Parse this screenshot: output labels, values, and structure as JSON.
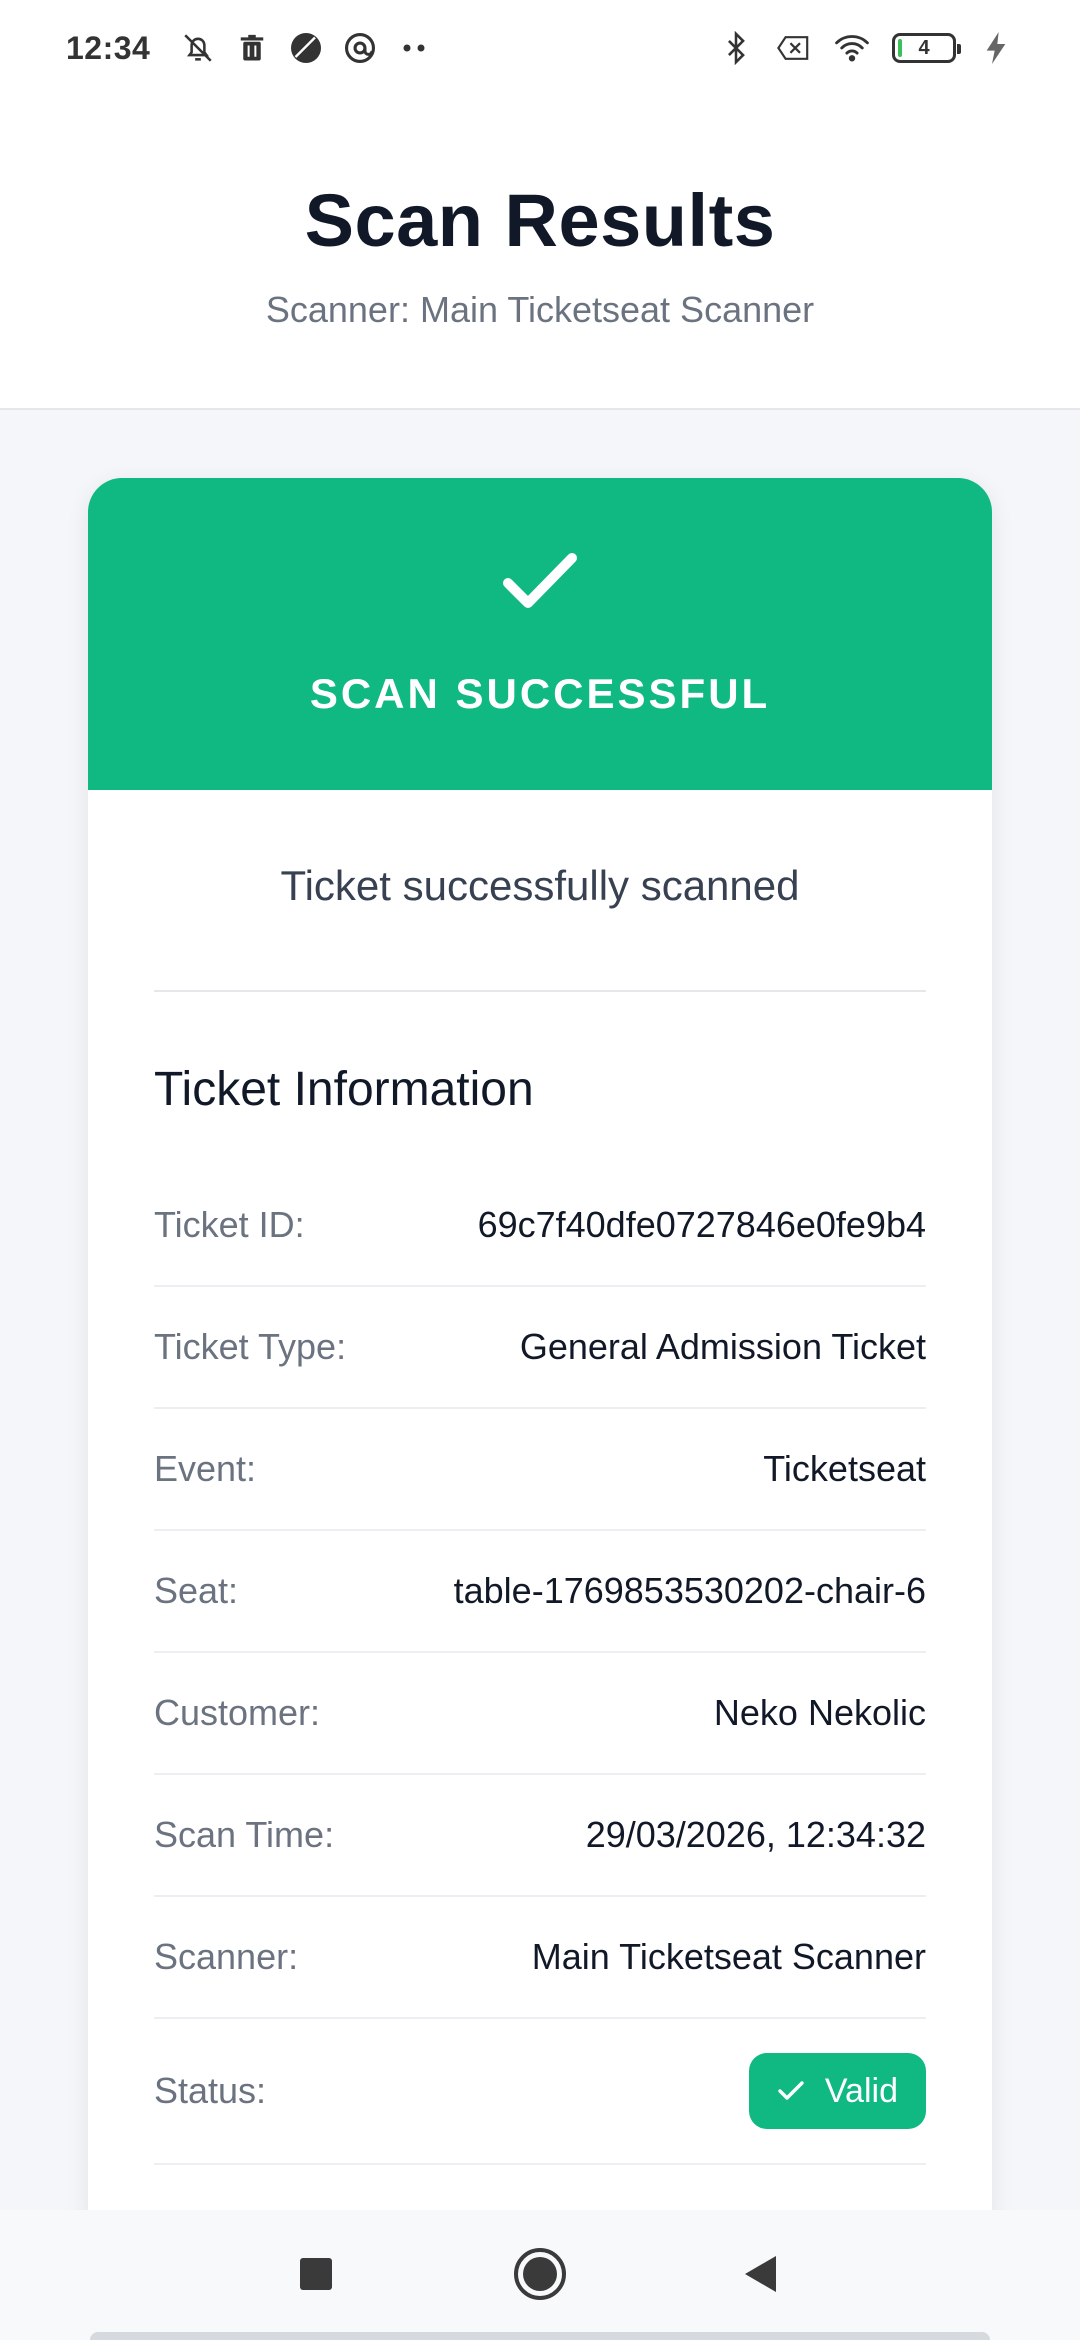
{
  "status_bar": {
    "time": "12:34",
    "battery_level": "4",
    "left_icons": [
      "bell-muted-icon",
      "trash-icon",
      "moon-icon",
      "at-sign-icon",
      "more-dots-icon"
    ],
    "right_icons": [
      "bluetooth-icon",
      "no-sim-icon",
      "wifi-icon",
      "battery-icon",
      "charging-bolt-icon"
    ]
  },
  "header": {
    "title": "Scan Results",
    "subtitle": "Scanner: Main Ticketseat Scanner"
  },
  "result": {
    "banner_label": "SCAN SUCCESSFUL",
    "message": "Ticket successfully scanned",
    "accent_color": "#10b981"
  },
  "ticket_info": {
    "section_title": "Ticket Information",
    "rows": [
      {
        "label": "Ticket ID:",
        "value": "69c7f40dfe0727846e0fe9b4"
      },
      {
        "label": "Ticket Type:",
        "value": "General Admission Ticket"
      },
      {
        "label": "Event:",
        "value": "Ticketseat"
      },
      {
        "label": "Seat:",
        "value": "table-1769853530202-chair-6"
      },
      {
        "label": "Customer:",
        "value": "Neko Nekolic"
      },
      {
        "label": "Scan Time:",
        "value": "29/03/2026, 12:34:32"
      },
      {
        "label": "Scanner:",
        "value": "Main Ticketseat Scanner"
      }
    ],
    "status_label": "Status:",
    "status_value": "Valid"
  },
  "nav": {
    "buttons": [
      "recents-square-icon",
      "home-circle-icon",
      "back-triangle-icon"
    ]
  }
}
